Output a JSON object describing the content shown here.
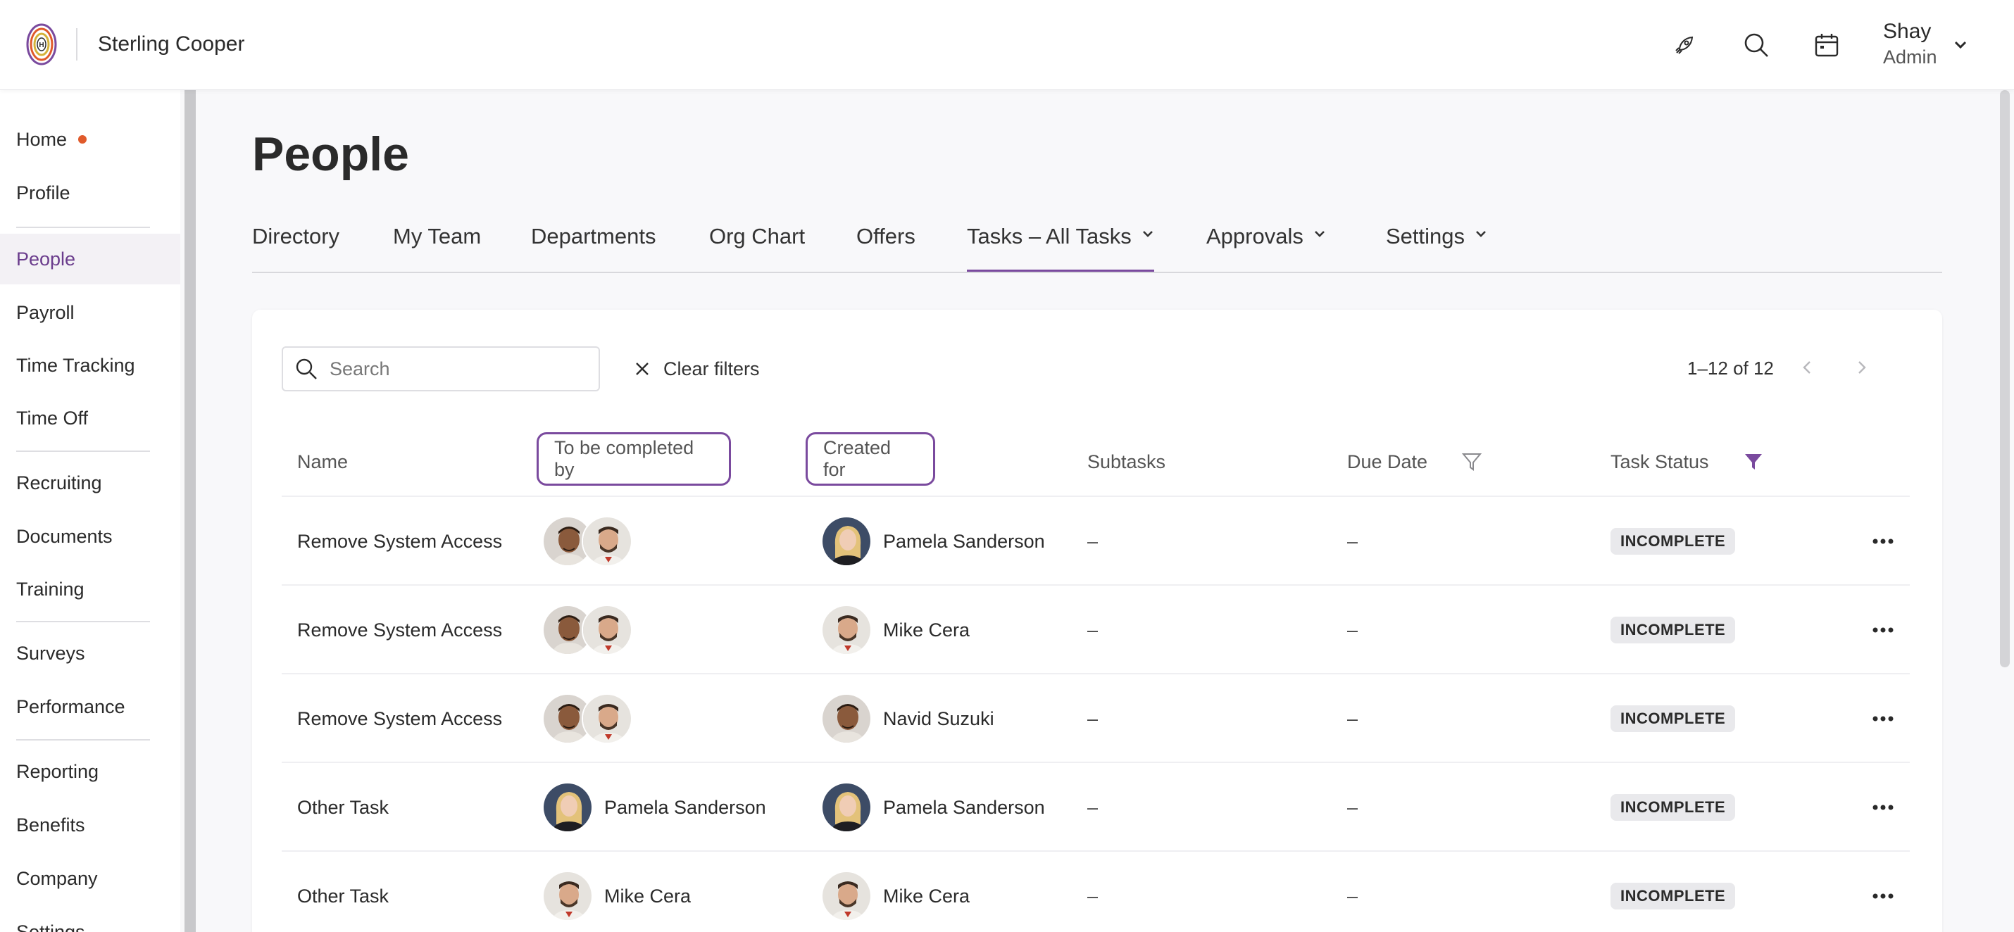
{
  "header": {
    "company": "Sterling Cooper",
    "user_name": "Shay",
    "user_role": "Admin",
    "icons": [
      "rocket-icon",
      "search-icon",
      "calendar-icon",
      "chevron-down-icon"
    ]
  },
  "sidebar": {
    "items": [
      {
        "label": "Home"
      },
      {
        "label": "Profile"
      },
      {
        "label": "People"
      },
      {
        "label": "Payroll"
      },
      {
        "label": "Time Tracking"
      },
      {
        "label": "Time Off"
      },
      {
        "label": "Recruiting"
      },
      {
        "label": "Documents"
      },
      {
        "label": "Training"
      },
      {
        "label": "Surveys"
      },
      {
        "label": "Performance"
      },
      {
        "label": "Reporting"
      },
      {
        "label": "Benefits"
      },
      {
        "label": "Company"
      },
      {
        "label": "Settings"
      }
    ],
    "active": "People",
    "notification_color": "#e05a2b"
  },
  "page": {
    "title": "People",
    "tabs": [
      {
        "label": "Directory"
      },
      {
        "label": "My Team"
      },
      {
        "label": "Departments"
      },
      {
        "label": "Org Chart"
      },
      {
        "label": "Offers"
      },
      {
        "label": "Tasks – All Tasks"
      },
      {
        "label": "Approvals"
      },
      {
        "label": "Settings"
      }
    ],
    "active_tab": "Tasks – All Tasks",
    "accent_color": "#7a4a9e"
  },
  "toolbar": {
    "search_placeholder": "Search",
    "clear_filters": "Clear filters",
    "pagination": "1–12 of 12"
  },
  "table": {
    "headers": {
      "name": "Name",
      "completed_by": "To be completed by",
      "created_for": "Created for",
      "subtasks": "Subtasks",
      "due_date": "Due Date",
      "task_status": "Task Status"
    },
    "rows": [
      {
        "name": "Remove System Access",
        "completed_by": "",
        "created_for": "Pamela Sanderson",
        "subtasks": "–",
        "due_date": "–",
        "status": "INCOMPLETE"
      },
      {
        "name": "Remove System Access",
        "completed_by": "",
        "created_for": "Mike Cera",
        "subtasks": "–",
        "due_date": "–",
        "status": "INCOMPLETE"
      },
      {
        "name": "Remove System Access",
        "completed_by": "",
        "created_for": "Navid Suzuki",
        "subtasks": "–",
        "due_date": "–",
        "status": "INCOMPLETE"
      },
      {
        "name": "Other Task",
        "completed_by": "Pamela Sanderson",
        "created_for": "Pamela Sanderson",
        "subtasks": "–",
        "due_date": "–",
        "status": "INCOMPLETE"
      },
      {
        "name": "Other Task",
        "completed_by": "Mike Cera",
        "created_for": "Mike Cera",
        "subtasks": "–",
        "due_date": "–",
        "status": "INCOMPLETE"
      }
    ]
  }
}
